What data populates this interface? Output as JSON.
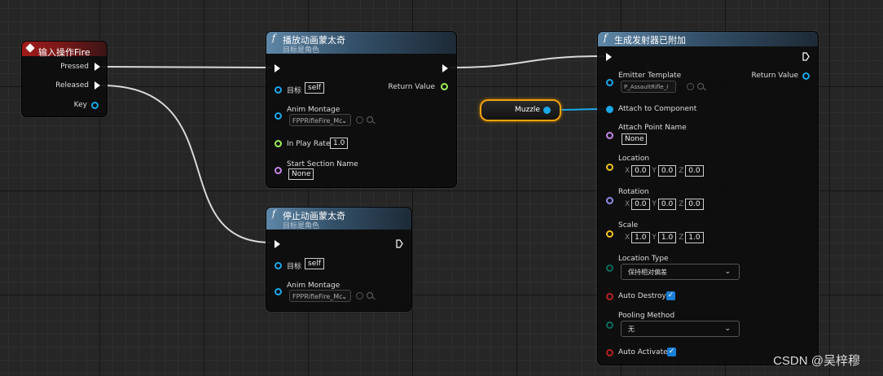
{
  "event_node": {
    "title": "输入操作Fire",
    "pins": {
      "pressed": "Pressed",
      "released": "Released",
      "key": "Key"
    }
  },
  "play_node": {
    "func_icon": "f",
    "title": "播放动画蒙太奇",
    "subtitle": "目标是角色",
    "target_label": "目标",
    "target_value": "self",
    "return_label": "Return Value",
    "montage_label": "Anim Montage",
    "montage_value": "FPPRifleFire_Mc",
    "rate_label": "In Play Rate",
    "rate_value": "1.0",
    "section_label": "Start Section Name",
    "section_value": "None"
  },
  "stop_node": {
    "func_icon": "f",
    "title": "停止动画蒙太奇",
    "subtitle": "目标是角色",
    "target_label": "目标",
    "target_value": "self",
    "montage_label": "Anim Montage",
    "montage_value": "FPPRifleFire_Mc"
  },
  "spawn_node": {
    "func_icon": "f",
    "title": "生成发射器已附加",
    "emitter_label": "Emitter Template",
    "emitter_value": "P_AssaultRifle_I",
    "return_label": "Return Value",
    "attach_label": "Attach to Component",
    "attach_point_label": "Attach Point Name",
    "attach_point_value": "None",
    "location_label": "Location",
    "location": {
      "x": "0.0",
      "y": "0.0",
      "z": "0.0"
    },
    "rotation_label": "Rotation",
    "rotation": {
      "x": "0.0",
      "y": "0.0",
      "z": "0.0"
    },
    "scale_label": "Scale",
    "scale": {
      "x": "1.0",
      "y": "1.0",
      "z": "1.0"
    },
    "axis": {
      "x": "X",
      "y": "Y",
      "z": "Z"
    },
    "location_type_label": "Location Type",
    "location_type_value": "保持相对偏差",
    "auto_destroy_label": "Auto Destroy",
    "pooling_label": "Pooling Method",
    "pooling_value": "无",
    "auto_activate_label": "Auto Activate"
  },
  "variable_node": {
    "label": "Muzzle"
  },
  "watermark": "CSDN @吴梓穆",
  "colors": {
    "exec": "#ffffff",
    "object": "#1aa8e8",
    "float": "#9ef05a",
    "vector": "#f2c31b",
    "name": "#c386e8",
    "bool": "#b52222",
    "enum": "#0b6b5c",
    "event_header": "#a21a1a",
    "function_header": "#5f87a8",
    "variable_border": "#f0a20b"
  }
}
